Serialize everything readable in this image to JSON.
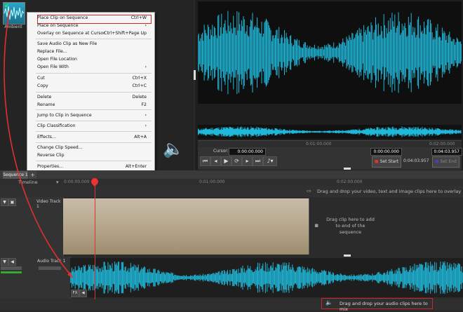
{
  "clip_bin": {
    "clip_name": "Ambient"
  },
  "context_menu": {
    "items": [
      {
        "label": "Place Clip on Sequence",
        "shortcut": "Ctrl+W"
      },
      {
        "label": "Place on Sequence",
        "shortcut": "›"
      },
      {
        "label": "Overlay on Sequence at Cursor",
        "shortcut": "Ctrl+Shift+Page Up"
      },
      {
        "label": "Save Audio Clip as New File",
        "shortcut": ""
      },
      {
        "label": "Replace File...",
        "shortcut": ""
      },
      {
        "label": "Open File Location",
        "shortcut": ""
      },
      {
        "label": "Open File With",
        "shortcut": "›"
      },
      {
        "label": "Cut",
        "shortcut": "Ctrl+X"
      },
      {
        "label": "Copy",
        "shortcut": "Ctrl+C"
      },
      {
        "label": "Delete",
        "shortcut": "Delete"
      },
      {
        "label": "Rename",
        "shortcut": "F2"
      },
      {
        "label": "Jump to Clip in Sequence",
        "shortcut": "›"
      },
      {
        "label": "Clip Classification",
        "shortcut": "›"
      },
      {
        "label": "Effects...",
        "shortcut": "Alt+A"
      },
      {
        "label": "Change Clip Speed...",
        "shortcut": ""
      },
      {
        "label": "Reverse Clip",
        "shortcut": ""
      },
      {
        "label": "Properties...",
        "shortcut": "Alt+Enter"
      }
    ]
  },
  "preview": {
    "mini_tick": "0:01:00.000",
    "mini_tick_right": "0:02:00.000",
    "cursor_label": "Cursor:",
    "cursor_value": "0:00:00.000",
    "start_value": "0:00:00.000",
    "end_value": "0:04:03.957",
    "duration": "0:04:03.957",
    "set_start": "Set Start",
    "set_end": "Set End"
  },
  "timeline": {
    "tab_label": "Sequence 1",
    "tab_close": "×",
    "add_tab": "+",
    "ruler_label": "Timeline",
    "ruler_ticks": [
      "0:00:00.000",
      "0:01:00.000",
      "0:02:00.000"
    ],
    "overlay_hint": "Drag and drop your video, text and image clips here to overlay",
    "video_track_label": "Video Track 1",
    "video_hint": "Drag clip here to add to end of the sequence",
    "audio_track_label": "Audio Track 1",
    "fx_label": "FX",
    "mix_hint": "Drag and drop your audio clips here to mix"
  },
  "colors": {
    "waveform": "#1fb8d8",
    "highlight": "#d0262a",
    "playhead": "#dd3333"
  }
}
